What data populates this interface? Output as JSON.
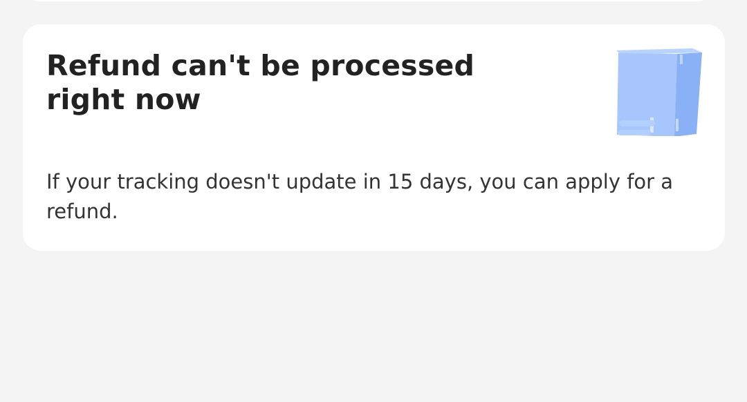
{
  "notice_card": {
    "title": "Refund can't be processed right now",
    "message": "If your tracking doesn't update in 15 days, you can apply for a refund.",
    "illustration_icon": "moving-package-icon"
  },
  "colors": {
    "background": "#f4f4f4",
    "card": "#ffffff",
    "title_text": "#222222",
    "body_text": "#333333",
    "box_light": "#a9c9ff",
    "box_mid": "#9bbcf9",
    "box_dark": "#8ab0f5"
  }
}
